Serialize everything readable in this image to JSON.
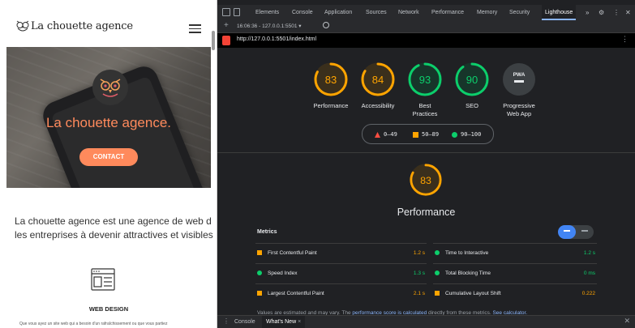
{
  "site": {
    "logo_text": "La chouette agence",
    "hero_title": "La chouette agence.",
    "contact_label": "CONTACT",
    "intro_line1": "La chouette agence est une agence de web d",
    "intro_line2": "les entreprises à devenir attractives et visibles",
    "service_title": "WEB DESIGN",
    "service_desc": "Que vous ayez un site web qui a besoin d'un rafraîchissement ou que vous partiez"
  },
  "devtools": {
    "tabs": [
      "Elements",
      "Console",
      "Application",
      "Sources",
      "Network",
      "Performance",
      "Memory",
      "Security",
      "Lighthouse"
    ],
    "active_tab": "Lighthouse",
    "more_tabs": "»",
    "report_select": "16:06:36 - 127.0.0.1:5501 ▾",
    "url": "http://127.0.0.1:5501/index.html",
    "gauges": [
      {
        "score": "83",
        "label1": "Performance",
        "label2": "",
        "status": "average"
      },
      {
        "score": "84",
        "label1": "Accessibility",
        "label2": "",
        "status": "average"
      },
      {
        "score": "93",
        "label1": "Best",
        "label2": "Practices",
        "status": "pass"
      },
      {
        "score": "90",
        "label1": "SEO",
        "label2": "",
        "status": "pass"
      },
      {
        "score": "PWA",
        "label1": "Progressive",
        "label2": "Web App",
        "status": "pwa"
      }
    ],
    "legend": {
      "fail": "0–49",
      "average": "50–89",
      "pass": "90–100"
    },
    "performance": {
      "score": "83",
      "title": "Performance",
      "metrics_title": "Metrics",
      "metrics": [
        {
          "name": "First Contentful Paint",
          "value": "1.2 s",
          "status": "average"
        },
        {
          "name": "Time to Interactive",
          "value": "1.2 s",
          "status": "pass"
        },
        {
          "name": "Speed Index",
          "value": "1.3 s",
          "status": "pass"
        },
        {
          "name": "Total Blocking Time",
          "value": "0 ms",
          "status": "pass"
        },
        {
          "name": "Largest Contentful Paint",
          "value": "2.1 s",
          "status": "average"
        },
        {
          "name": "Cumulative Layout Shift",
          "value": "0.222",
          "status": "average"
        }
      ],
      "note_prefix": "Values are estimated and may vary. The ",
      "note_link1": "performance score is calculated",
      "note_middle": " directly from these metrics. ",
      "note_link2": "See calculator."
    },
    "drawer_tabs": [
      "Console",
      "What's New"
    ],
    "drawer_active": "What's New",
    "colors": {
      "pass": "#0cce6b",
      "average": "#ffa400",
      "fail": "#ff4e42",
      "bg": "#202124"
    }
  }
}
